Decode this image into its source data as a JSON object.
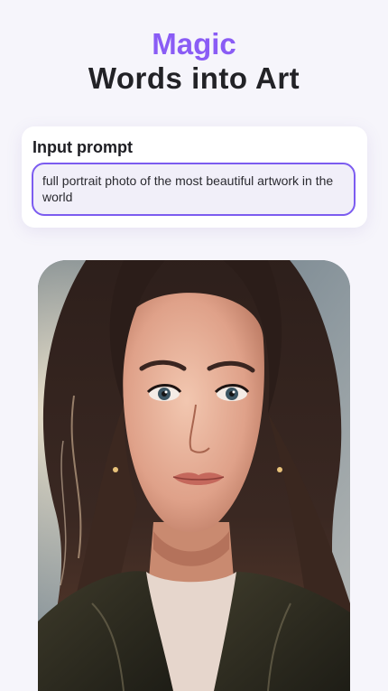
{
  "headline": {
    "accent": "Magic",
    "title": "Words into Art"
  },
  "prompt": {
    "label": "Input prompt",
    "value": "full portrait photo of the most beautiful artwork in the world"
  },
  "colors": {
    "accent": "#8a5cf5",
    "input_border": "#7c5cf0",
    "title": "#222226"
  }
}
